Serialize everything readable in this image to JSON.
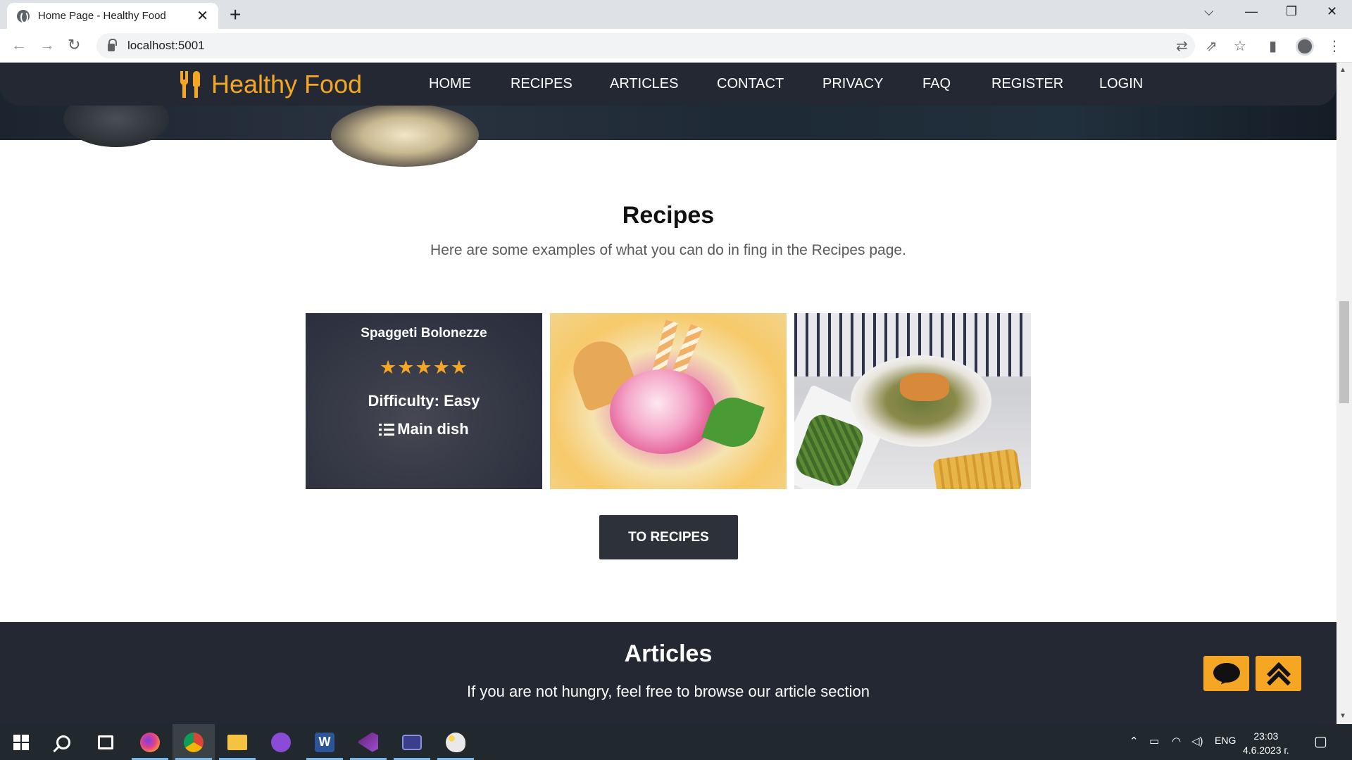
{
  "browser": {
    "tab_title": "Home Page - Healthy Food",
    "tab_close": "✕",
    "new_tab": "+",
    "url": "localhost:5001"
  },
  "nav": {
    "logo_text": "Healthy Food",
    "links": [
      "HOME",
      "RECIPES",
      "ARTICLES",
      "CONTACT",
      "PRIVACY",
      "FAQ",
      "REGISTER",
      "LOGIN"
    ]
  },
  "recipes": {
    "title": "Recipes",
    "subtitle": "Here are some examples of what you can do in fing in the Recipes page.",
    "cards": [
      {
        "name": "Spaggeti Bolonezze",
        "stars": "★★★★★",
        "rating": 5,
        "difficulty": "Difficulty: Easy",
        "category": "Main dish"
      }
    ],
    "button_label": "TO RECIPES"
  },
  "articles": {
    "title": "Articles",
    "subtitle": "If you are not hungry, feel free to browse our article section"
  },
  "taskbar": {
    "language": "ENG",
    "time": "23:03",
    "date": "4.6.2023 г."
  },
  "colors": {
    "accent": "#f5a623",
    "navbar": "#232833",
    "button": "#2d3139"
  }
}
